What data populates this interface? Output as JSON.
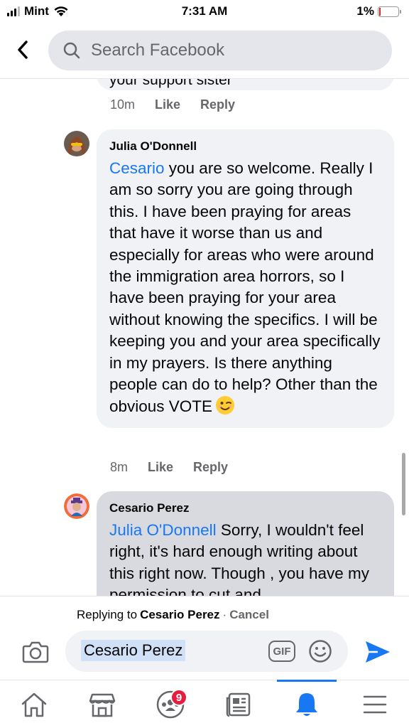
{
  "status_bar": {
    "carrier": "Mint",
    "time": "7:31 AM",
    "battery_percent": "1%"
  },
  "header": {
    "search_placeholder": "Search Facebook"
  },
  "previous_comment": {
    "fragment": "your support sister",
    "time": "10m",
    "like_label": "Like",
    "reply_label": "Reply"
  },
  "comments": [
    {
      "author": "Julia O'Donnell",
      "mention": "Cesario",
      "text": " you are so welcome. Really I am so sorry you are going through this. I have been praying for areas that have it worse than us and especially for areas who were around the immigration area horrors, so I have been praying for your area without knowing the specifics. I will be keeping you and your area specifically in my prayers. Is there anything people can do to help? Other than the obvious VOTE",
      "emoji": "winking-face",
      "time": "8m",
      "like_label": "Like",
      "reply_label": "Reply"
    },
    {
      "author": "Cesario Perez",
      "mention": "Julia O'Donnell",
      "text": " Sorry, I  wouldn't feel right, it's hard enough writing about this right now. Though , you have my permission to cut and"
    }
  ],
  "reply_bar": {
    "replying_to_label": "Replying to",
    "replying_to_name": "Cesario Perez",
    "separator": "·",
    "cancel_label": "Cancel",
    "composer_text": "Cesario Perez",
    "gif_label": "GIF"
  },
  "bottom_nav": {
    "groups_badge": "9",
    "active_tab": "notifications"
  },
  "colors": {
    "accent": "#1877f2",
    "badge": "#e41e3f",
    "bubble": "#f0f2f5",
    "bubble_selected": "#d8dadf"
  }
}
